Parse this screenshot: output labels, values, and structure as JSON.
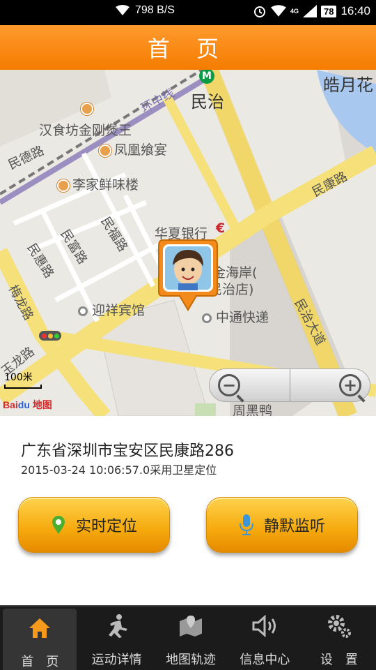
{
  "status_bar": {
    "net_speed": "798 B/S",
    "battery": "78",
    "network": "4G",
    "time": "16:40",
    "icons": [
      "wifi-icon",
      "alarm-icon",
      "wifi-icon",
      "signal-icon",
      "battery-icon"
    ]
  },
  "header": {
    "title": "首 页"
  },
  "map": {
    "labels": {
      "minzhi_metro": "民治",
      "huanzhong": "环中线",
      "haoyue": "皓月花",
      "hanshifang": "汉食坊金刚煲王",
      "fenghuang": "凤凰飨宴",
      "minde": "民德路",
      "lijia": "李家鲜味楼",
      "minkang": "民康路",
      "minfu": "民福路",
      "minfu2": "民富路",
      "minhui": "民惠路",
      "huaxia": "华夏银行",
      "huangjin_1": "黄金海岸(",
      "huangjin_2": "民治店)",
      "yingxiang": "迎祥宾馆",
      "zhongtong": "中通快递",
      "meilong": "梅龙路",
      "yulong": "玉龙路",
      "minzhi_dadao": "民治大道",
      "zhouheiya": "周黑鸭"
    },
    "scale": "100米",
    "logo": "Baidu地图"
  },
  "location": {
    "address": "广东省深圳市宝安区民康路286",
    "time_info": "2015-03-24 10:06:57.0采用卫星定位"
  },
  "actions": {
    "realtime": "实时定位",
    "silent": "静默监听"
  },
  "colors": {
    "accent": "#f57c00",
    "button": "#f5a90c",
    "nav_bg": "#1b1b1b"
  },
  "nav": [
    {
      "label": "首　页",
      "icon": "home-icon",
      "active": true
    },
    {
      "label": "运动详情",
      "icon": "running-icon",
      "active": false
    },
    {
      "label": "地图轨迹",
      "icon": "map-icon",
      "active": false
    },
    {
      "label": "信息中心",
      "icon": "speaker-icon",
      "active": false
    },
    {
      "label": "设　置",
      "icon": "gear-icon",
      "active": false
    }
  ]
}
